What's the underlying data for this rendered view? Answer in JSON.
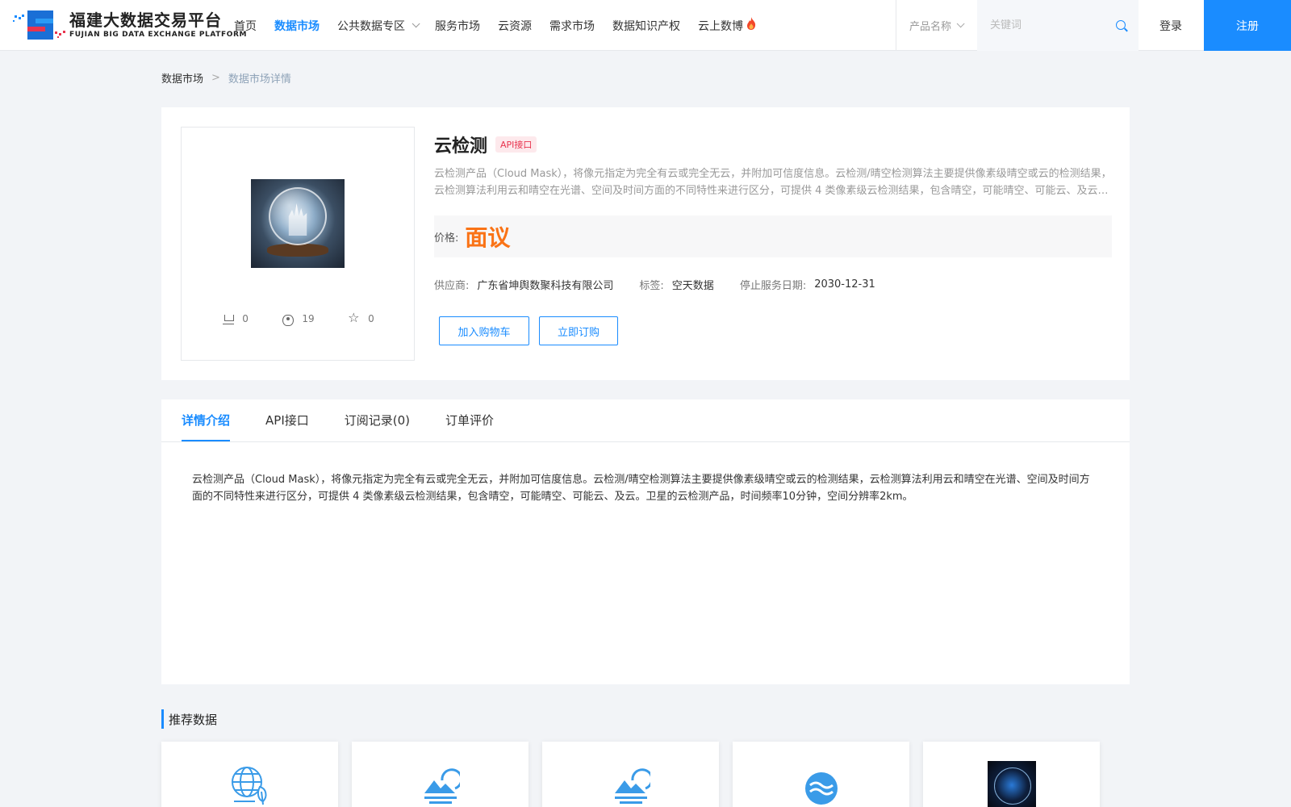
{
  "header": {
    "logo_cn": "福建大数据交易平台",
    "logo_en": "FUJIAN BIG DATA EXCHANGE PLATFORM",
    "nav": [
      {
        "label": "首页"
      },
      {
        "label": "数据市场",
        "active": true
      },
      {
        "label": "公共数据专区",
        "dropdown": true
      },
      {
        "label": "服务市场"
      },
      {
        "label": "云资源"
      },
      {
        "label": "需求市场"
      },
      {
        "label": "数据知识产权"
      },
      {
        "label": "云上数博",
        "badge_icon": "fire-icon"
      }
    ],
    "search_type": "产品名称",
    "search_placeholder": "关键词",
    "login": "登录",
    "register": "注册"
  },
  "breadcrumb": {
    "root": "数据市场",
    "separator": ">",
    "current": "数据市场详情"
  },
  "product": {
    "title": "云检测",
    "badge": "API接口",
    "description": "云检测产品（Cloud Mask），将像元指定为完全有云或完全无云，并附加可信度信息。云检测/晴空检测算法主要提供像素级晴空或云的检测结果，云检测算法利用云和晴空在光谱、空间及时间方面的不同特性来进行区分，可提供 4 类像素级云检测结果，包含晴空，可能晴空、可能云、及云。卫星的云检测产品，时间频率10分钟，空间分辨率2km。",
    "price_label": "价格:",
    "price_value": "面议",
    "supplier_label": "供应商:",
    "supplier": "广东省坤舆数聚科技有限公司",
    "tag_label": "标签:",
    "tag": "空天数据",
    "end_date_label": "停止服务日期:",
    "end_date": "2030-12-31",
    "stats": {
      "cart": "0",
      "views": "19",
      "favorites": "0"
    },
    "add_cart": "加入购物车",
    "buy_now": "立即订购"
  },
  "tabs": [
    {
      "label": "详情介绍",
      "active": true
    },
    {
      "label": "API接口"
    },
    {
      "label": "订阅记录(0)"
    },
    {
      "label": "订单评价"
    }
  ],
  "tab_content": "云检测产品（Cloud Mask），将像元指定为完全有云或完全无云，并附加可信度信息。云检测/晴空检测算法主要提供像素级晴空或云的检测结果，云检测算法利用云和晴空在光谱、空间及时间方面的不同特性来进行区分，可提供 4 类像素级云检测结果，包含晴空，可能晴空、可能云、及云。卫星的云检测产品，时间频率10分钟，空间分辨率2km。",
  "recommend": {
    "title": "推荐数据",
    "items": [
      {
        "icon": "globe-leaf-icon"
      },
      {
        "icon": "sun-cloud-icon"
      },
      {
        "icon": "sun-cloud-icon"
      },
      {
        "icon": "water-wave-icon"
      },
      {
        "icon": "earth-photo"
      }
    ]
  },
  "colors": {
    "primary": "#1a8cff",
    "price": "#fa7316",
    "badge_bg": "#fde9ec",
    "badge_text": "#e8344e"
  }
}
